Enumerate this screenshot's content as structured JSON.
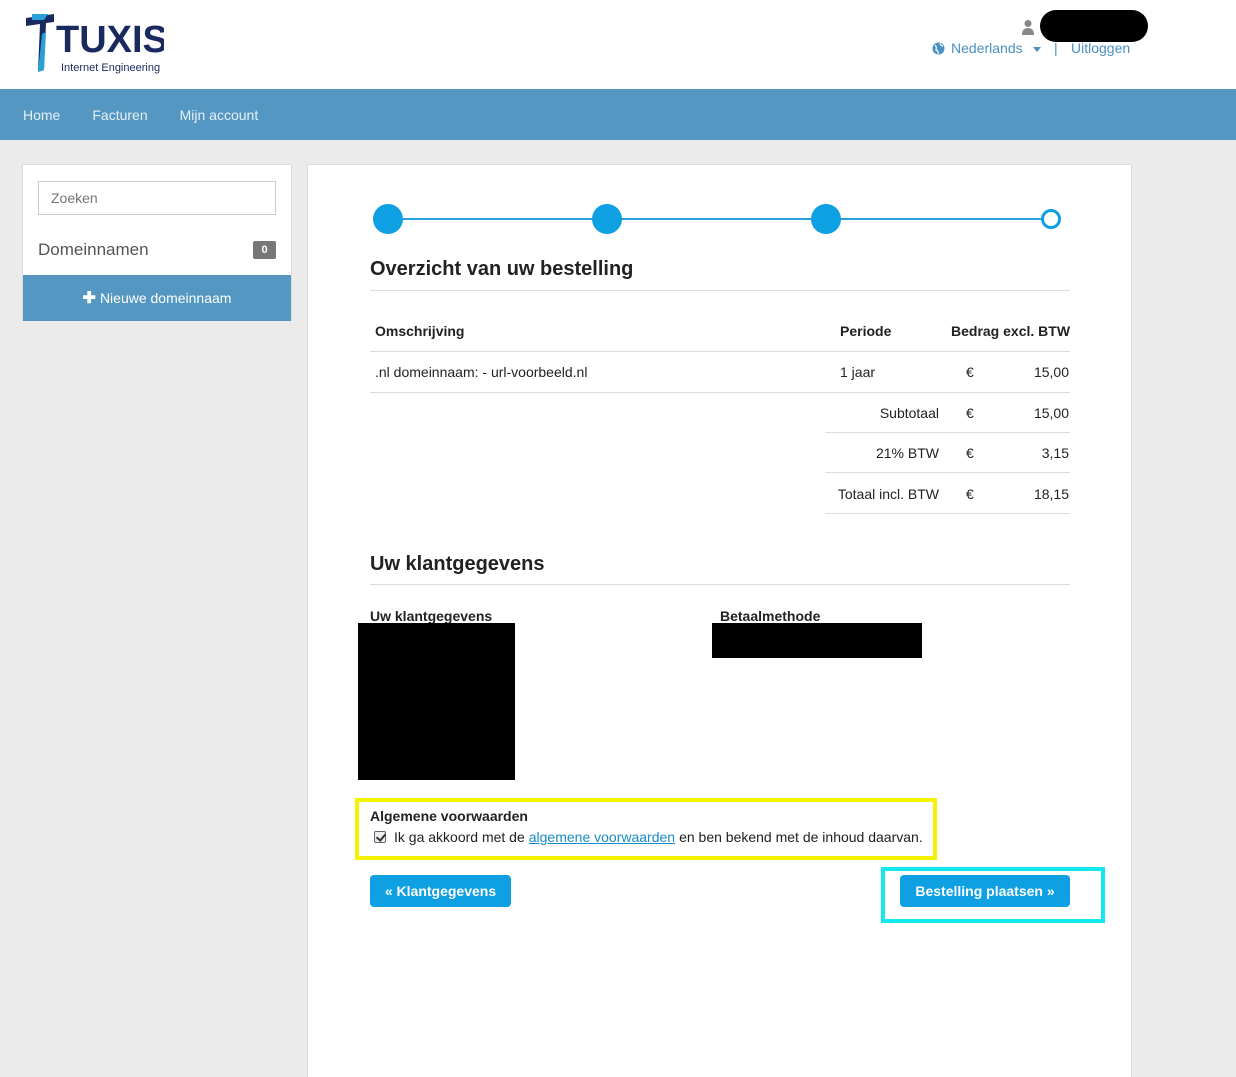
{
  "brand": {
    "name": "TUXIS",
    "tagline": "Internet Engineering"
  },
  "header": {
    "language": "Nederlands",
    "separator": "|",
    "logout": "Uitloggen"
  },
  "nav": {
    "items": [
      "Home",
      "Facturen",
      "Mijn account"
    ]
  },
  "sidebar": {
    "search_placeholder": "Zoeken",
    "domains_label": "Domeinnamen",
    "domains_count": "0",
    "new_domain_label": "Nieuwe domeinnaam"
  },
  "order": {
    "title": "Overzicht van uw bestelling",
    "columns": {
      "description": "Omschrijving",
      "period": "Periode",
      "amount": "Bedrag excl. BTW"
    },
    "line": {
      "description": ".nl domeinnaam: - url-voorbeeld.nl",
      "period": "1 jaar",
      "currency": "€",
      "amount": "15,00"
    },
    "subtotal": {
      "label": "Subtotaal",
      "currency": "€",
      "amount": "15,00"
    },
    "vat": {
      "label": "21% BTW",
      "currency": "€",
      "amount": "3,15"
    },
    "total": {
      "label": "Totaal incl. BTW",
      "currency": "€",
      "amount": "18,15"
    }
  },
  "customer": {
    "title": "Uw klantgegevens",
    "details_label": "Uw klantgegevens",
    "payment_label": "Betaalmethode"
  },
  "terms": {
    "title": "Algemene voorwaarden",
    "checked": true,
    "text_before": "Ik ga akkoord met de",
    "link": "algemene voorwaarden",
    "text_after": "en ben bekend met de inhoud daarvan."
  },
  "actions": {
    "back": "« Klantgegevens",
    "submit": "Bestelling plaatsen »"
  },
  "colors": {
    "nav": "#5397c2",
    "primary": "#0fa0e3",
    "highlight_terms": "#f3f300",
    "highlight_submit": "#12e8f0"
  }
}
